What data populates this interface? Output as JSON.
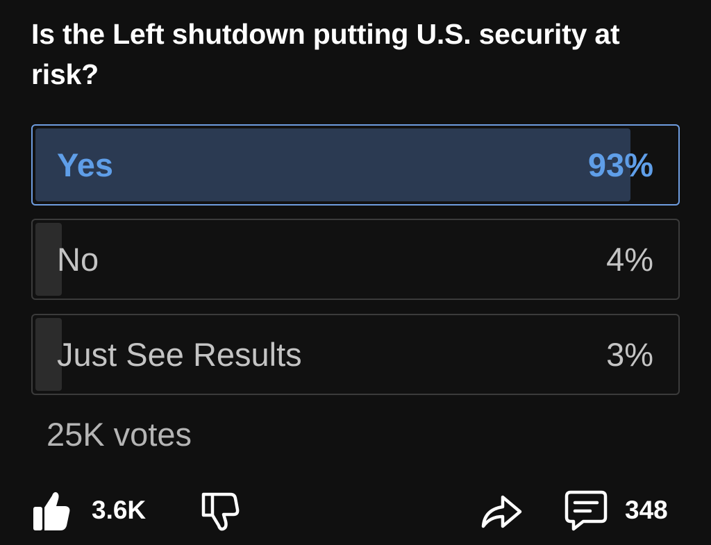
{
  "poll": {
    "question": "Is the Left shutdown putting U.S. security at risk?",
    "options": [
      {
        "label": "Yes",
        "percent_label": "93%",
        "percent": 93,
        "selected": true
      },
      {
        "label": "No",
        "percent_label": "4%",
        "percent": 4,
        "selected": false
      },
      {
        "label": "Just See Results",
        "percent_label": "3%",
        "percent": 3,
        "selected": false
      }
    ],
    "votes": "25K votes"
  },
  "actions": {
    "like_count": "3.6K",
    "comment_count": "348"
  },
  "icons": {
    "like": "thumbs-up-icon",
    "dislike": "thumbs-down-icon",
    "share": "share-arrow-icon",
    "comment": "comment-icon"
  },
  "colors": {
    "background": "#101010",
    "accent": "#5f9ee8",
    "selected_fill": "#2b3a52",
    "unselected_fill": "#2c2c2c",
    "muted_text": "#c4c4c4"
  }
}
